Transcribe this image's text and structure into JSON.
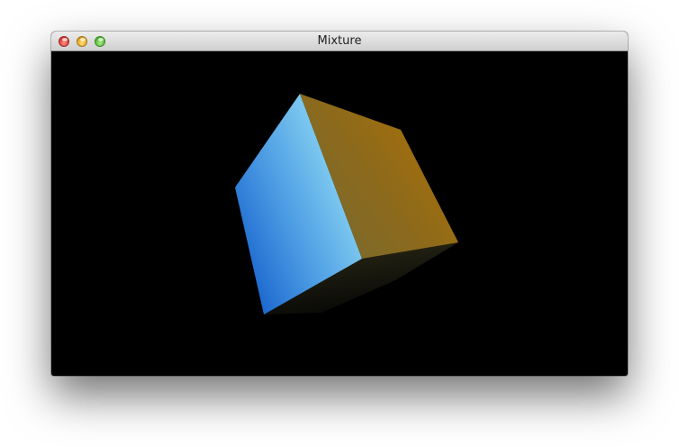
{
  "window": {
    "title": "Mixture"
  },
  "titlebar": {
    "buttons": [
      "close",
      "minimize",
      "zoom"
    ]
  },
  "viewport": {
    "background": "#000000",
    "scene": {
      "object": "cube",
      "left_face_color": "#4fa3e8",
      "right_face_color": "#a8780f",
      "bottom_face_color": "#1a1a10"
    }
  },
  "colors": {
    "close": "#e0443e",
    "minimize": "#e9ae27",
    "zoom": "#5cbf3c"
  }
}
